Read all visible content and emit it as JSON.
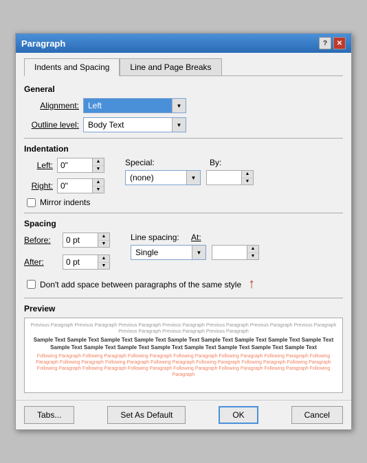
{
  "dialog": {
    "title": "Paragraph",
    "help_label": "?",
    "close_label": "✕"
  },
  "tabs": [
    {
      "id": "indents-spacing",
      "label": "Indents and Spacing",
      "active": true
    },
    {
      "id": "line-page-breaks",
      "label": "Line and Page Breaks",
      "active": false
    }
  ],
  "general": {
    "label": "General",
    "alignment_label": "Alignment:",
    "alignment_value": "Left",
    "outline_label": "Outline level:",
    "outline_value": "Body Text"
  },
  "indentation": {
    "label": "Indentation",
    "left_label": "Left:",
    "left_value": "0\"",
    "right_label": "Right:",
    "right_value": "0\"",
    "special_label": "Special:",
    "special_value": "(none)",
    "by_label": "By:",
    "by_value": "",
    "mirror_label": "Mirror indents"
  },
  "spacing": {
    "label": "Spacing",
    "before_label": "Before:",
    "before_value": "0 pt",
    "after_label": "After:",
    "after_value": "0 pt",
    "line_spacing_label": "Line spacing:",
    "line_spacing_value": "Single",
    "at_label": "At:",
    "at_value": "",
    "dont_add_label": "Don't add space between paragraphs of the same style"
  },
  "preview": {
    "label": "Preview",
    "previous_text": "Previous Paragraph Previous Paragraph Previous Paragraph Previous Paragraph Previous Paragraph Previous Paragraph Previous Paragraph Previous Paragraph Previous Paragraph Previous Paragraph",
    "sample_text": "Sample Text Sample Text Sample Text Sample Text Sample Text Sample Text Sample Text Sample Text Sample Text Sample Text Sample Text Sample Text Sample Text Sample Text Sample Text Sample Text Sample Text",
    "following_text": "Following Paragraph Following Paragraph Following Paragraph Following Paragraph Following Paragraph Following Paragraph Following Paragraph Following Paragraph Following Paragraph Following Paragraph Following Paragraph Following Paragraph Following Paragraph Following Paragraph Following Paragraph Following Paragraph Following Paragraph Following Paragraph Following Paragraph Following Paragraph"
  },
  "buttons": {
    "tabs_label": "Tabs...",
    "set_default_label": "Set As Default",
    "ok_label": "OK",
    "cancel_label": "Cancel"
  },
  "icons": {
    "dropdown": "▼",
    "spin_up": "▲",
    "spin_down": "▼"
  }
}
